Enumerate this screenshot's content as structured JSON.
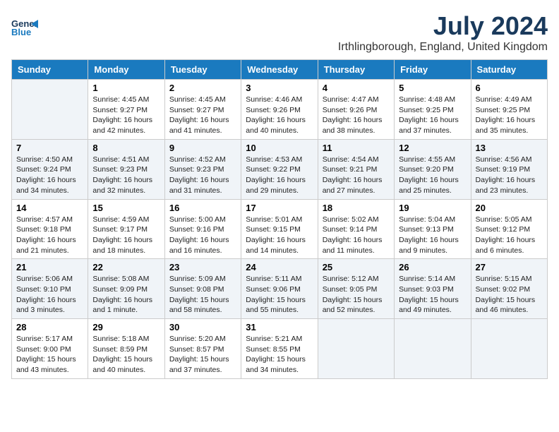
{
  "header": {
    "logo_line1": "General",
    "logo_line2": "Blue",
    "month_year": "July 2024",
    "location": "Irthlingborough, England, United Kingdom"
  },
  "days_of_week": [
    "Sunday",
    "Monday",
    "Tuesday",
    "Wednesday",
    "Thursday",
    "Friday",
    "Saturday"
  ],
  "weeks": [
    [
      {
        "day": "",
        "content": ""
      },
      {
        "day": "1",
        "content": "Sunrise: 4:45 AM\nSunset: 9:27 PM\nDaylight: 16 hours\nand 42 minutes."
      },
      {
        "day": "2",
        "content": "Sunrise: 4:45 AM\nSunset: 9:27 PM\nDaylight: 16 hours\nand 41 minutes."
      },
      {
        "day": "3",
        "content": "Sunrise: 4:46 AM\nSunset: 9:26 PM\nDaylight: 16 hours\nand 40 minutes."
      },
      {
        "day": "4",
        "content": "Sunrise: 4:47 AM\nSunset: 9:26 PM\nDaylight: 16 hours\nand 38 minutes."
      },
      {
        "day": "5",
        "content": "Sunrise: 4:48 AM\nSunset: 9:25 PM\nDaylight: 16 hours\nand 37 minutes."
      },
      {
        "day": "6",
        "content": "Sunrise: 4:49 AM\nSunset: 9:25 PM\nDaylight: 16 hours\nand 35 minutes."
      }
    ],
    [
      {
        "day": "7",
        "content": "Sunrise: 4:50 AM\nSunset: 9:24 PM\nDaylight: 16 hours\nand 34 minutes."
      },
      {
        "day": "8",
        "content": "Sunrise: 4:51 AM\nSunset: 9:23 PM\nDaylight: 16 hours\nand 32 minutes."
      },
      {
        "day": "9",
        "content": "Sunrise: 4:52 AM\nSunset: 9:23 PM\nDaylight: 16 hours\nand 31 minutes."
      },
      {
        "day": "10",
        "content": "Sunrise: 4:53 AM\nSunset: 9:22 PM\nDaylight: 16 hours\nand 29 minutes."
      },
      {
        "day": "11",
        "content": "Sunrise: 4:54 AM\nSunset: 9:21 PM\nDaylight: 16 hours\nand 27 minutes."
      },
      {
        "day": "12",
        "content": "Sunrise: 4:55 AM\nSunset: 9:20 PM\nDaylight: 16 hours\nand 25 minutes."
      },
      {
        "day": "13",
        "content": "Sunrise: 4:56 AM\nSunset: 9:19 PM\nDaylight: 16 hours\nand 23 minutes."
      }
    ],
    [
      {
        "day": "14",
        "content": "Sunrise: 4:57 AM\nSunset: 9:18 PM\nDaylight: 16 hours\nand 21 minutes."
      },
      {
        "day": "15",
        "content": "Sunrise: 4:59 AM\nSunset: 9:17 PM\nDaylight: 16 hours\nand 18 minutes."
      },
      {
        "day": "16",
        "content": "Sunrise: 5:00 AM\nSunset: 9:16 PM\nDaylight: 16 hours\nand 16 minutes."
      },
      {
        "day": "17",
        "content": "Sunrise: 5:01 AM\nSunset: 9:15 PM\nDaylight: 16 hours\nand 14 minutes."
      },
      {
        "day": "18",
        "content": "Sunrise: 5:02 AM\nSunset: 9:14 PM\nDaylight: 16 hours\nand 11 minutes."
      },
      {
        "day": "19",
        "content": "Sunrise: 5:04 AM\nSunset: 9:13 PM\nDaylight: 16 hours\nand 9 minutes."
      },
      {
        "day": "20",
        "content": "Sunrise: 5:05 AM\nSunset: 9:12 PM\nDaylight: 16 hours\nand 6 minutes."
      }
    ],
    [
      {
        "day": "21",
        "content": "Sunrise: 5:06 AM\nSunset: 9:10 PM\nDaylight: 16 hours\nand 3 minutes."
      },
      {
        "day": "22",
        "content": "Sunrise: 5:08 AM\nSunset: 9:09 PM\nDaylight: 16 hours\nand 1 minute."
      },
      {
        "day": "23",
        "content": "Sunrise: 5:09 AM\nSunset: 9:08 PM\nDaylight: 15 hours\nand 58 minutes."
      },
      {
        "day": "24",
        "content": "Sunrise: 5:11 AM\nSunset: 9:06 PM\nDaylight: 15 hours\nand 55 minutes."
      },
      {
        "day": "25",
        "content": "Sunrise: 5:12 AM\nSunset: 9:05 PM\nDaylight: 15 hours\nand 52 minutes."
      },
      {
        "day": "26",
        "content": "Sunrise: 5:14 AM\nSunset: 9:03 PM\nDaylight: 15 hours\nand 49 minutes."
      },
      {
        "day": "27",
        "content": "Sunrise: 5:15 AM\nSunset: 9:02 PM\nDaylight: 15 hours\nand 46 minutes."
      }
    ],
    [
      {
        "day": "28",
        "content": "Sunrise: 5:17 AM\nSunset: 9:00 PM\nDaylight: 15 hours\nand 43 minutes."
      },
      {
        "day": "29",
        "content": "Sunrise: 5:18 AM\nSunset: 8:59 PM\nDaylight: 15 hours\nand 40 minutes."
      },
      {
        "day": "30",
        "content": "Sunrise: 5:20 AM\nSunset: 8:57 PM\nDaylight: 15 hours\nand 37 minutes."
      },
      {
        "day": "31",
        "content": "Sunrise: 5:21 AM\nSunset: 8:55 PM\nDaylight: 15 hours\nand 34 minutes."
      },
      {
        "day": "",
        "content": ""
      },
      {
        "day": "",
        "content": ""
      },
      {
        "day": "",
        "content": ""
      }
    ]
  ]
}
